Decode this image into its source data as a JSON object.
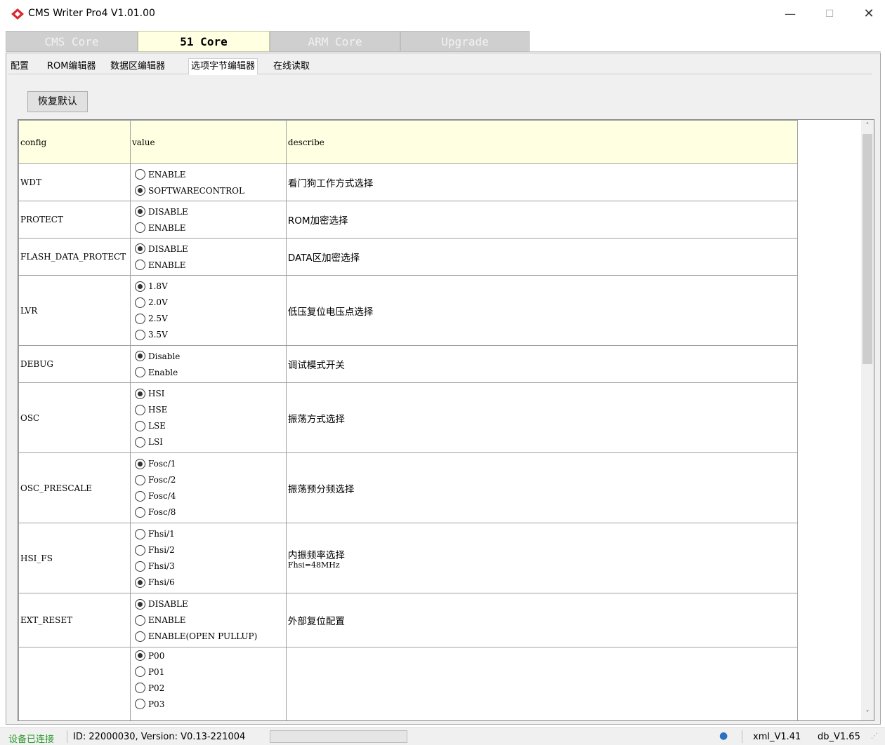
{
  "window": {
    "title": "CMS Writer Pro4 V1.01.00",
    "minimize": "—",
    "maximize": "☐",
    "close": "✕"
  },
  "core_tabs": [
    {
      "label": "CMS Core",
      "active": false
    },
    {
      "label": "51 Core",
      "active": true
    },
    {
      "label": "ARM Core",
      "active": false
    },
    {
      "label": "Upgrade",
      "active": false
    }
  ],
  "sub_tabs": [
    {
      "label": "配置"
    },
    {
      "label": "ROM编辑器"
    },
    {
      "label": "数据区编辑器"
    },
    {
      "label": "选项字节编辑器",
      "active": true
    },
    {
      "label": "在线读取"
    }
  ],
  "toolbar": {
    "restore_label": "恢复默认"
  },
  "grid": {
    "headers": {
      "config": "config",
      "value": "value",
      "describe": "describe"
    },
    "rows": [
      {
        "config": "WDT",
        "describe": "看门狗工作方式选择",
        "options": [
          {
            "label": "ENABLE",
            "checked": false
          },
          {
            "label": "SOFTWARECONTROL",
            "checked": true
          }
        ]
      },
      {
        "config": "PROTECT",
        "describe": "ROM加密选择",
        "options": [
          {
            "label": "DISABLE",
            "checked": true
          },
          {
            "label": "ENABLE",
            "checked": false
          }
        ]
      },
      {
        "config": "FLASH_DATA_PROTECT",
        "describe": "DATA区加密选择",
        "options": [
          {
            "label": "DISABLE",
            "checked": true
          },
          {
            "label": "ENABLE",
            "checked": false
          }
        ]
      },
      {
        "config": "LVR",
        "describe": "低压复位电压点选择",
        "options": [
          {
            "label": "1.8V",
            "checked": true
          },
          {
            "label": "2.0V",
            "checked": false
          },
          {
            "label": "2.5V",
            "checked": false
          },
          {
            "label": "3.5V",
            "checked": false
          }
        ]
      },
      {
        "config": "DEBUG",
        "describe": "调试模式开关",
        "options": [
          {
            "label": "Disable",
            "checked": true
          },
          {
            "label": "Enable",
            "checked": false
          }
        ]
      },
      {
        "config": "OSC",
        "describe": "振荡方式选择",
        "options": [
          {
            "label": "HSI",
            "checked": true
          },
          {
            "label": "HSE",
            "checked": false
          },
          {
            "label": "LSE",
            "checked": false
          },
          {
            "label": "LSI",
            "checked": false
          }
        ]
      },
      {
        "config": "OSC_PRESCALE",
        "describe": "振荡预分频选择",
        "options": [
          {
            "label": "Fosc/1",
            "checked": true
          },
          {
            "label": "Fosc/2",
            "checked": false
          },
          {
            "label": "Fosc/4",
            "checked": false
          },
          {
            "label": "Fosc/8",
            "checked": false
          }
        ]
      },
      {
        "config": "HSI_FS",
        "describe": "内振频率选择",
        "describe_sub": "Fhsi=48MHz",
        "options": [
          {
            "label": "Fhsi/1",
            "checked": false
          },
          {
            "label": "Fhsi/2",
            "checked": false
          },
          {
            "label": "Fhsi/3",
            "checked": false
          },
          {
            "label": "Fhsi/6",
            "checked": true
          }
        ]
      },
      {
        "config": "EXT_RESET",
        "describe": "外部复位配置",
        "options": [
          {
            "label": "DISABLE",
            "checked": true
          },
          {
            "label": "ENABLE",
            "checked": false
          },
          {
            "label": "ENABLE(OPEN PULLUP)",
            "checked": false
          }
        ]
      },
      {
        "config": "",
        "describe": "",
        "options": [
          {
            "label": "P00",
            "checked": true
          },
          {
            "label": "P01",
            "checked": false
          },
          {
            "label": "P02",
            "checked": false
          },
          {
            "label": "P03",
            "checked": false
          }
        ]
      }
    ]
  },
  "scrollbar": {
    "up": "˄",
    "down": "˅"
  },
  "statusbar": {
    "connection": "设备已连接",
    "device_info": "ID: 22000030, Version: V0.13-221004",
    "xml_version": "xml_V1.41",
    "db_version": "db_V1.65",
    "globe_icon": "●",
    "grip": "⋰"
  },
  "colors": {
    "header_bg": "#ffffe1",
    "active_core_tab_bg": "#ffffe1",
    "inactive_core_tab_bg": "#cfcfcf",
    "connected_text": "#2e9b2e",
    "logo_red": "#d9282f"
  }
}
